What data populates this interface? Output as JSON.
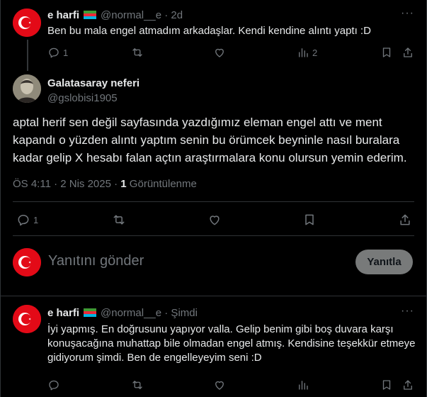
{
  "colors": {
    "background": "#000000",
    "text": "#e7e9ea",
    "secondary": "#71767b",
    "divider": "#2f3336",
    "flag_red": "#e30a17"
  },
  "top_tweet": {
    "name": "e harfi",
    "handle_time": "@normal__e · 2d",
    "text": "Ben bu mala engel atmadım arkadaşlar. Kendi kendine alıntı yaptı :D",
    "reply_count": "1",
    "view_count": "2",
    "icons": [
      "reply-icon",
      "retweet-icon",
      "like-icon",
      "views-icon",
      "bookmark-icon",
      "share-icon",
      "more-icon",
      "azerbaijan-flag-icon"
    ]
  },
  "main_tweet": {
    "name": "Galatasaray neferi",
    "handle": "@gslobisi1905",
    "text": "aptal herif sen değil sayfasında yazdığımız eleman engel attı ve ment kapandı o yüzden alıntı yaptım senin bu örümcek beyninle nasıl buralara kadar gelip X hesabı falan açtın araştırmalara konu olursun yemin ederim.",
    "time_date": "ÖS 4:11 · 2 Nis 2025 · ",
    "views_number": "1",
    "views_label": " Görüntülenme",
    "reply_count": "1"
  },
  "reply_box": {
    "placeholder": "Yanıtını gönder",
    "button_label": "Yanıtla"
  },
  "bottom_tweet": {
    "name": "e harfi",
    "handle_time": "@normal__e · Şimdi",
    "text": "İyi yapmış. En doğrusunu yapıyor valla. Gelip benim gibi boş duvara karşı konuşacağına muhattap bile olmadan engel atmış. Kendisine teşekkür etmeye gidiyorum şimdi. Ben de engelleyeyim seni :D"
  }
}
